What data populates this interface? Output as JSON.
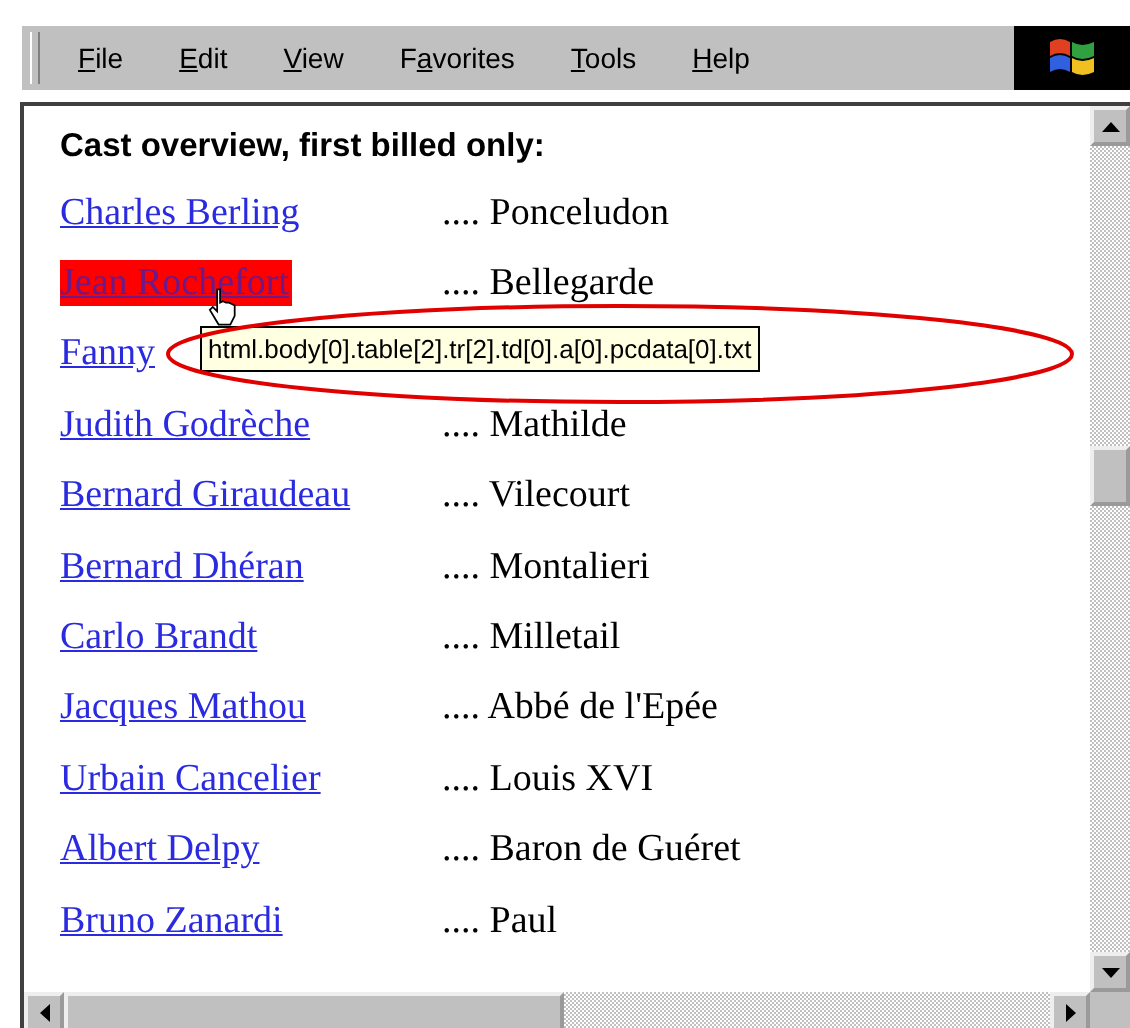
{
  "menu_bar": [
    {
      "key": "F",
      "post": "ile"
    },
    {
      "key": "E",
      "post": "dit"
    },
    {
      "key": "V",
      "post": "iew"
    },
    {
      "pre": "F",
      "key": "a",
      "post": "vorites"
    },
    {
      "key": "T",
      "post": "ools"
    },
    {
      "key": "H",
      "post": "elp"
    }
  ],
  "heading": "Cast overview, first billed only:",
  "cast": [
    {
      "name": "Charles Berling",
      "role": ".... Ponceludon",
      "highlighted": false
    },
    {
      "name": "Jean Rochefort",
      "role": ".... Bellegarde",
      "highlighted": true
    },
    {
      "name": "Fanny",
      "highlighted": false
    },
    {
      "name": "Judith Godrèche",
      "role": ".... Mathilde",
      "highlighted": false
    },
    {
      "name": "Bernard Giraudeau",
      "role": ".... Vilecourt",
      "highlighted": false
    },
    {
      "name": "Bernard Dhéran",
      "role": ".... Montalieri",
      "highlighted": false
    },
    {
      "name": "Carlo Brandt",
      "role": ".... Milletail",
      "highlighted": false
    },
    {
      "name": "Jacques Mathou",
      "role": ".... Abbé de l'Epée",
      "highlighted": false
    },
    {
      "name": "Urbain Cancelier",
      "role": ".... Louis XVI",
      "highlighted": false
    },
    {
      "name": "Albert Delpy",
      "role": ".... Baron de Guéret",
      "highlighted": false
    },
    {
      "name": "Bruno Zanardi",
      "role": ".... Paul",
      "highlighted": false
    }
  ],
  "tooltip": "html.body[0].table[2].tr[2].td[0].a[0].pcdata[0].txt"
}
